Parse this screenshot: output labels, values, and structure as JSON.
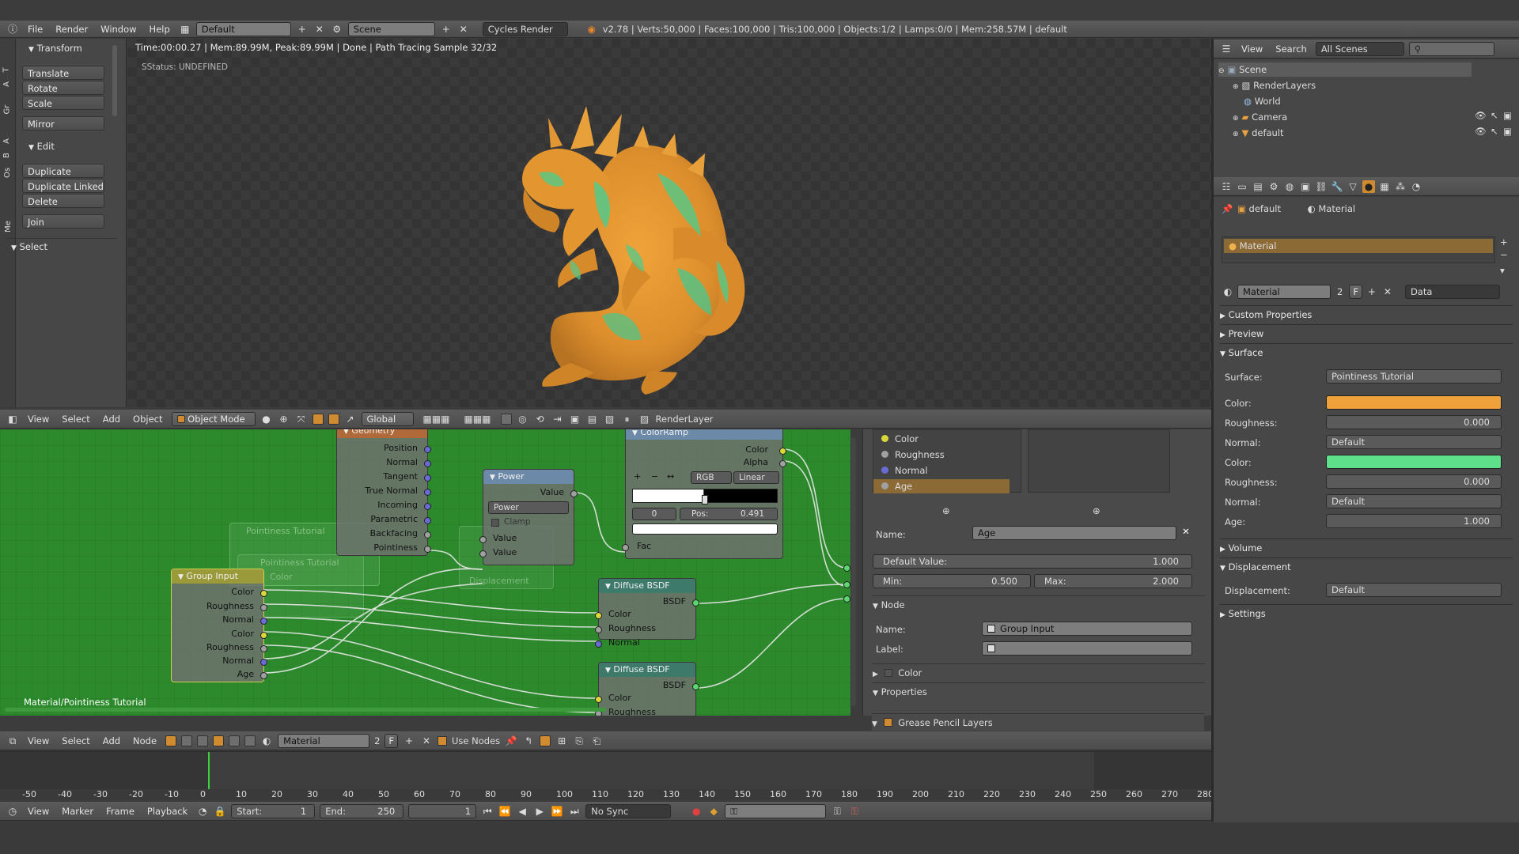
{
  "top_bar": {
    "menus": [
      "File",
      "Render",
      "Window",
      "Help"
    ],
    "layout": "Default",
    "scene": "Scene",
    "engine": "Cycles Render",
    "stats": "v2.78 | Verts:50,000 | Faces:100,000 | Tris:100,000 | Objects:1/2 | Lamps:0/0 | Mem:258.57M | default"
  },
  "toolshelf": {
    "tabs": [
      "T",
      "A",
      "Gr",
      "A",
      "B",
      "Os",
      "Me"
    ],
    "transform_title": "Transform",
    "transform_buttons": [
      "Translate",
      "Rotate",
      "Scale",
      "Mirror"
    ],
    "edit_title": "Edit",
    "edit_buttons": [
      "Duplicate",
      "Duplicate Linked",
      "Delete",
      "Join"
    ],
    "select_title": "Select"
  },
  "viewport": {
    "render_info": "Time:00:00.27 | Mem:89.99M, Peak:89.99M | Done | Path Tracing Sample 32/32",
    "status": "SStatus: UNDEFINED",
    "header": {
      "menus": [
        "View",
        "Select",
        "Add",
        "Object"
      ],
      "mode": "Object Mode",
      "orientation": "Global",
      "render_layer": "RenderLayer"
    }
  },
  "node_editor": {
    "breadcrumb": "Material/Pointiness Tutorial",
    "header": {
      "menus": [
        "View",
        "Select",
        "Add",
        "Node"
      ],
      "material": "Material",
      "users": "2",
      "fake": "F",
      "use_nodes": "Use Nodes"
    },
    "geometry_node": {
      "title": "Geometry",
      "outputs": [
        "Position",
        "Normal",
        "Tangent",
        "True Normal",
        "Incoming",
        "Parametric",
        "Backfacing",
        "Pointiness"
      ]
    },
    "power_node": {
      "title": "Power",
      "output": "Value",
      "operation": "Power",
      "clamp": "Clamp",
      "inputs": [
        "Value",
        "Value"
      ]
    },
    "colorramp_node": {
      "title": "ColorRamp",
      "outputs": [
        "Color",
        "Alpha"
      ],
      "mode": "RGB",
      "interp": "Linear",
      "index": "0",
      "pos_label": "Pos:",
      "pos_value": "0.491",
      "input": "Fac"
    },
    "group_input_node": {
      "title": "Group Input",
      "outputs": [
        "Color",
        "Roughness",
        "Normal",
        "Color",
        "Roughness",
        "Normal",
        "Age"
      ]
    },
    "diffuse1": {
      "title": "Diffuse BSDF",
      "output": "BSDF",
      "inputs": [
        "Color",
        "Roughness",
        "Normal"
      ]
    },
    "diffuse2": {
      "title": "Diffuse BSDF",
      "output": "BSDF",
      "inputs": [
        "Color",
        "Roughness"
      ]
    },
    "ghost": {
      "frame": "Pointiness Tutorial",
      "group": "Pointiness Tutorial",
      "color": "Color",
      "displacement": "Displacement"
    }
  },
  "node_sidebar": {
    "sockets": [
      "Color",
      "Roughness",
      "Normal",
      "Age"
    ],
    "name_label": "Name:",
    "name_value": "Age",
    "default_label": "Default Value:",
    "default_value": "1.000",
    "min_label": "Min:",
    "min_value": "0.500",
    "max_label": "Max:",
    "max_value": "2.000",
    "node_section": "Node",
    "node_name_label": "Name:",
    "node_name_value": "Group Input",
    "node_label_label": "Label:",
    "color_section": "Color",
    "properties_section": "Properties",
    "gp_section": "Grease Pencil Layers"
  },
  "outliner": {
    "menus": [
      "View",
      "Search"
    ],
    "scope": "All Scenes",
    "items": [
      "Scene",
      "RenderLayers",
      "World",
      "Camera",
      "default"
    ]
  },
  "properties": {
    "breadcrumb": [
      "default",
      "Material"
    ],
    "slot": "Material",
    "datablock": "Material",
    "users": "2",
    "fake": "F",
    "link": "Data",
    "sections": {
      "custom": "Custom Properties",
      "preview": "Preview",
      "surface": "Surface",
      "volume": "Volume",
      "displacement": "Displacement",
      "settings": "Settings"
    },
    "surface_label": "Surface:",
    "surface_value": "Pointiness Tutorial",
    "rows": [
      {
        "label": "Color:",
        "type": "color",
        "color": "#f0a23a"
      },
      {
        "label": "Roughness:",
        "type": "num",
        "value": "0.000"
      },
      {
        "label": "Normal:",
        "type": "text",
        "value": "Default"
      },
      {
        "label": "Color:",
        "type": "color",
        "color": "#5ee08a"
      },
      {
        "label": "Roughness:",
        "type": "num",
        "value": "0.000"
      },
      {
        "label": "Normal:",
        "type": "text",
        "value": "Default"
      },
      {
        "label": "Age:",
        "type": "num",
        "value": "1.000"
      }
    ],
    "displacement_label": "Displacement:",
    "displacement_value": "Default"
  },
  "timeline": {
    "ticks": [
      "-50",
      "-40",
      "-30",
      "-20",
      "-10",
      "0",
      "10",
      "20",
      "30",
      "40",
      "50",
      "60",
      "70",
      "80",
      "90",
      "100",
      "110",
      "120",
      "130",
      "140",
      "150",
      "160",
      "170",
      "180",
      "190",
      "200",
      "210",
      "220",
      "230",
      "240",
      "250",
      "260",
      "270",
      "280"
    ],
    "menus": [
      "View",
      "Marker",
      "Frame",
      "Playback"
    ],
    "start_label": "Start:",
    "start": "1",
    "end_label": "End:",
    "end": "250",
    "current": "1",
    "sync": "No Sync"
  },
  "colors": {
    "node_bg": "#2c8a2c",
    "accent": "#d08a2f",
    "active_row": "#8c6a35"
  }
}
